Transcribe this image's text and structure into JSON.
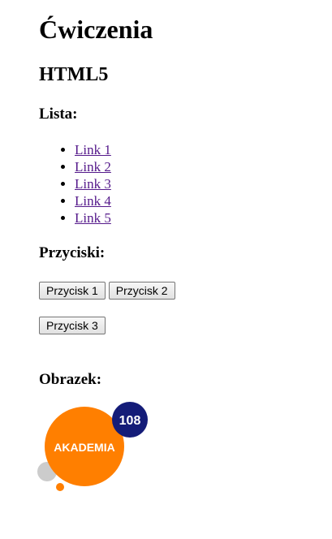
{
  "title": "Ćwiczenia",
  "subtitle": "HTML5",
  "list_section": {
    "heading": "Lista:",
    "links": [
      "Link 1",
      "Link 2",
      "Link 3",
      "Link 4",
      "Link 5"
    ]
  },
  "buttons_section": {
    "heading": "Przyciski:",
    "button_1": "Przycisk 1",
    "button_2": "Przycisk 2",
    "button_3": "Przycisk 3"
  },
  "image_section": {
    "heading": "Obrazek:",
    "logo_text": "AKADEMIA",
    "logo_number": "108"
  },
  "colors": {
    "link": "#551a8b",
    "logo_orange": "#ff7f00",
    "logo_navy": "#141c78",
    "logo_grey": "#cccccc"
  }
}
